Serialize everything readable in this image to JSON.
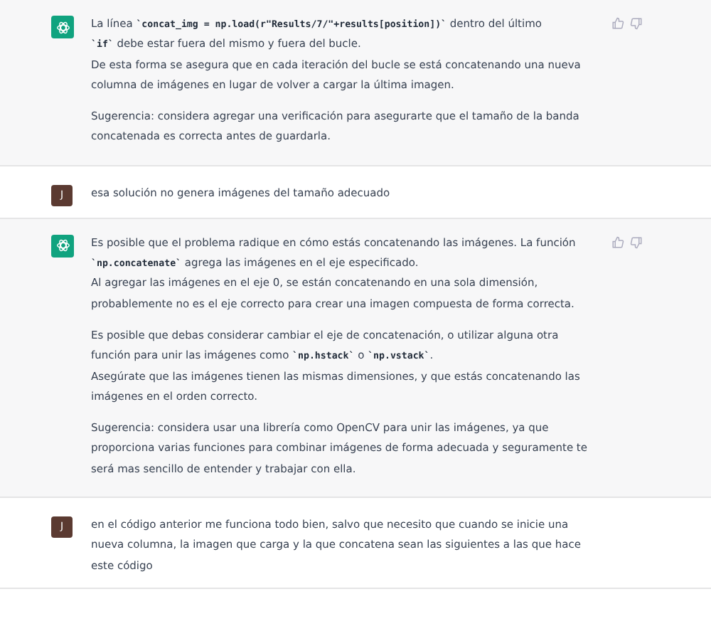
{
  "messages": [
    {
      "kind": "assistant",
      "paragraphs": [
        [
          [
            {
              "text": "La línea "
            },
            {
              "code": "`concat_img = np.load(r\"Results/7/\"+results[position])`"
            },
            {
              "text": " dentro del último"
            }
          ],
          [
            {
              "code": "`if`"
            },
            {
              "text": " debe estar fuera del mismo y fuera del bucle."
            }
          ],
          [
            {
              "text": "De esta forma se asegura que en cada iteración del bucle se está concatenando una nueva"
            }
          ],
          [
            {
              "text": "columna de imágenes en lugar de volver a cargar la última imagen."
            }
          ]
        ],
        [
          [
            {
              "text": "Sugerencia: considera agregar una verificación para asegurarte que el tamaño de la banda"
            }
          ],
          [
            {
              "text": "concatenada es correcta antes de guardarla."
            }
          ]
        ]
      ]
    },
    {
      "kind": "user",
      "avatar": "J",
      "paragraphs": [
        [
          [
            {
              "text": "esa solución no genera imágenes del tamaño adecuado"
            }
          ]
        ]
      ]
    },
    {
      "kind": "assistant",
      "paragraphs": [
        [
          [
            {
              "text": "Es posible que el problema radique en cómo estás concatenando las imágenes. La función"
            }
          ],
          [
            {
              "code": "`np.concatenate`"
            },
            {
              "text": " agrega las imágenes en el eje especificado."
            }
          ],
          [
            {
              "text": "Al agregar las imágenes en el eje 0, se están concatenando en una sola dimensión,"
            }
          ],
          [
            {
              "text": "probablemente no es el eje correcto para crear una imagen compuesta de forma correcta."
            }
          ]
        ],
        [
          [
            {
              "text": "Es posible que debas considerar cambiar el eje de concatenación, o utilizar alguna otra"
            }
          ],
          [
            {
              "text": "función para unir las imágenes como "
            },
            {
              "code": "`np.hstack`"
            },
            {
              "text": " o "
            },
            {
              "code": "`np.vstack`"
            },
            {
              "text": "."
            }
          ],
          [
            {
              "text": "Asegúrate que las imágenes tienen las mismas dimensiones, y que estás concatenando las"
            }
          ],
          [
            {
              "text": "imágenes en el orden correcto."
            }
          ]
        ],
        [
          [
            {
              "text": "Sugerencia: considera usar una librería como OpenCV para unir las imágenes, ya que"
            }
          ],
          [
            {
              "text": "proporciona varias funciones para combinar imágenes de forma adecuada y seguramente te"
            }
          ],
          [
            {
              "text": "será mas sencillo de entender y trabajar con ella."
            }
          ]
        ]
      ]
    },
    {
      "kind": "user",
      "avatar": "J",
      "paragraphs": [
        [
          [
            {
              "text": "en el código anterior me funciona todo bien, salvo que necesito que cuando se inicie una"
            }
          ],
          [
            {
              "text": "nueva columna, la imagen que carga y la que concatena sean las siguientes a las que hace"
            }
          ],
          [
            {
              "text": "este código"
            }
          ]
        ]
      ]
    }
  ]
}
